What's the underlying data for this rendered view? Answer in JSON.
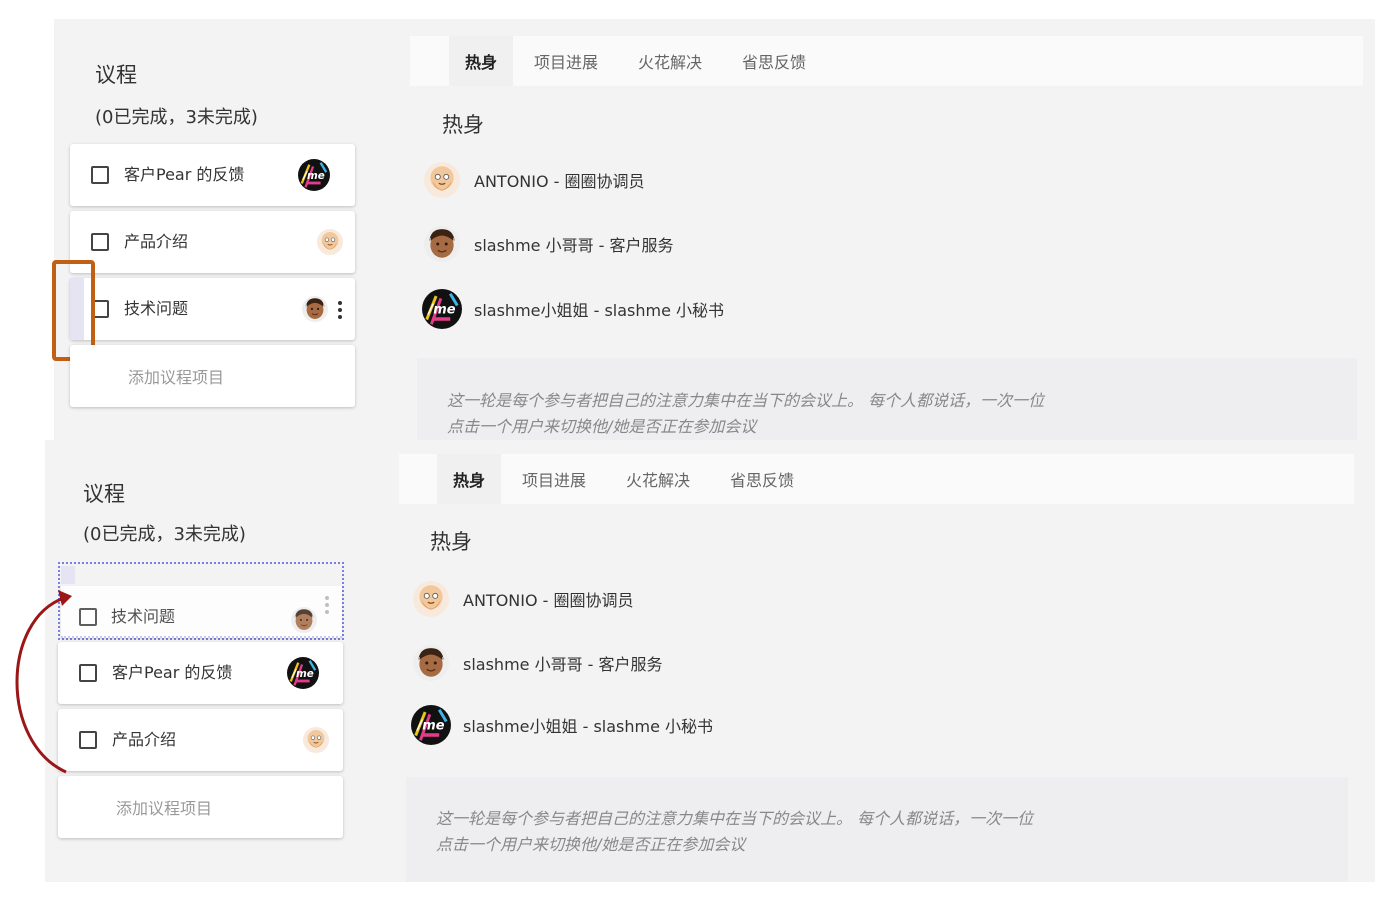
{
  "agenda": {
    "title": "议程",
    "count": "(0已完成，3未完成)",
    "add_label": "添加议程项目"
  },
  "tabs": [
    "热身",
    "项目进展",
    "火花解决",
    "省思反馈"
  ],
  "warmup": {
    "title": "热身",
    "participants": [
      {
        "name": "ANTONIO - 圈圈协调员",
        "avatar": "bald-man-avatar-icon"
      },
      {
        "name": "slashme 小哥哥 - 客户服务",
        "avatar": "man-avatar-icon"
      },
      {
        "name": "slashme小姐姐 - slashme 小秘书",
        "avatar": "slashme-logo-icon"
      }
    ],
    "desc_line1": "这一轮是每个参与者把自己的注意力集中在当下的会议上。 每个人都说话，一次一位",
    "desc_line2": "点击一个用户来切换他/她是否正在参加会议"
  },
  "before": {
    "items": [
      {
        "label": "客户Pear 的反馈",
        "avatar": "slashme-logo-icon"
      },
      {
        "label": "产品介绍",
        "avatar": "bald-man-avatar-icon"
      },
      {
        "label": "技术问题",
        "avatar": "man-avatar-icon"
      }
    ]
  },
  "after": {
    "dragged": {
      "label": "技术问题",
      "avatar": "man-avatar-icon"
    },
    "items": [
      {
        "label": "客户Pear 的反馈",
        "avatar": "slashme-logo-icon"
      },
      {
        "label": "产品介绍",
        "avatar": "bald-man-avatar-icon"
      }
    ]
  },
  "colors": {
    "highlight": "#c15f14",
    "arrow": "#9b1616",
    "drop_zone": "#7b7fe0",
    "panel_bg": "#f3f3f4"
  }
}
